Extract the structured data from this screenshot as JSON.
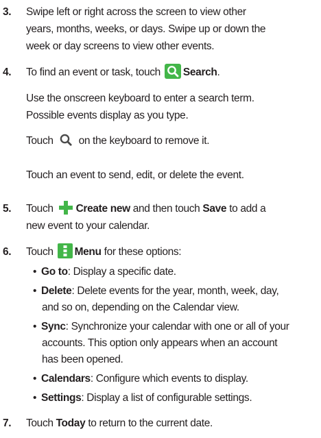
{
  "steps": {
    "s3": {
      "num": "3.",
      "lines": [
        "Swipe left or right across the screen to view other",
        "years, months, weeks, or days. Swipe up or down the",
        "week or day screens to view other events."
      ]
    },
    "s4": {
      "num": "4.",
      "pre": "To find an event or task, touch",
      "bold": "Search",
      "post": ".",
      "p1": [
        "Use the onscreen keyboard to enter a search term.",
        "Possible events display as you type."
      ],
      "p2_pre": "Touch",
      "p2_post": "on the keyboard to remove it.",
      "p3": "Touch an event to send, edit, or delete the event."
    },
    "s5": {
      "num": "5.",
      "pre": "Touch",
      "bold1": "Create new",
      "mid": "and then touch",
      "bold2": "Save",
      "post": "to add a",
      "line2": "new event to your calendar."
    },
    "s6": {
      "num": "6.",
      "pre": "Touch",
      "bold": "Menu",
      "post": "for these options:",
      "bullets": [
        {
          "term": "Go to",
          "text": ": Display a specific date.",
          "cont": []
        },
        {
          "term": "Delete",
          "text": ": Delete events for the year, month, week, day,",
          "cont": [
            "and so on, depending on the Calendar view."
          ]
        },
        {
          "term": "Sync",
          "text": ": Synchronize your calendar with one or all of your",
          "cont": [
            "accounts. This option only appears when an account",
            "has been opened."
          ]
        },
        {
          "term": "Calendars",
          "text": ": Configure which events to display.",
          "cont": []
        },
        {
          "term": "Settings",
          "text": ": Display a list of configurable settings.",
          "cont": []
        }
      ]
    },
    "s7": {
      "num": "7.",
      "pre": "Touch",
      "bold": "Today",
      "post": "to return to the current date."
    }
  },
  "icons": {
    "search_green": "search-icon",
    "search_plain": "search-icon",
    "create_new": "plus-icon",
    "menu": "menu-icon"
  },
  "colors": {
    "accent_green": "#43b649",
    "text": "#231f20"
  }
}
